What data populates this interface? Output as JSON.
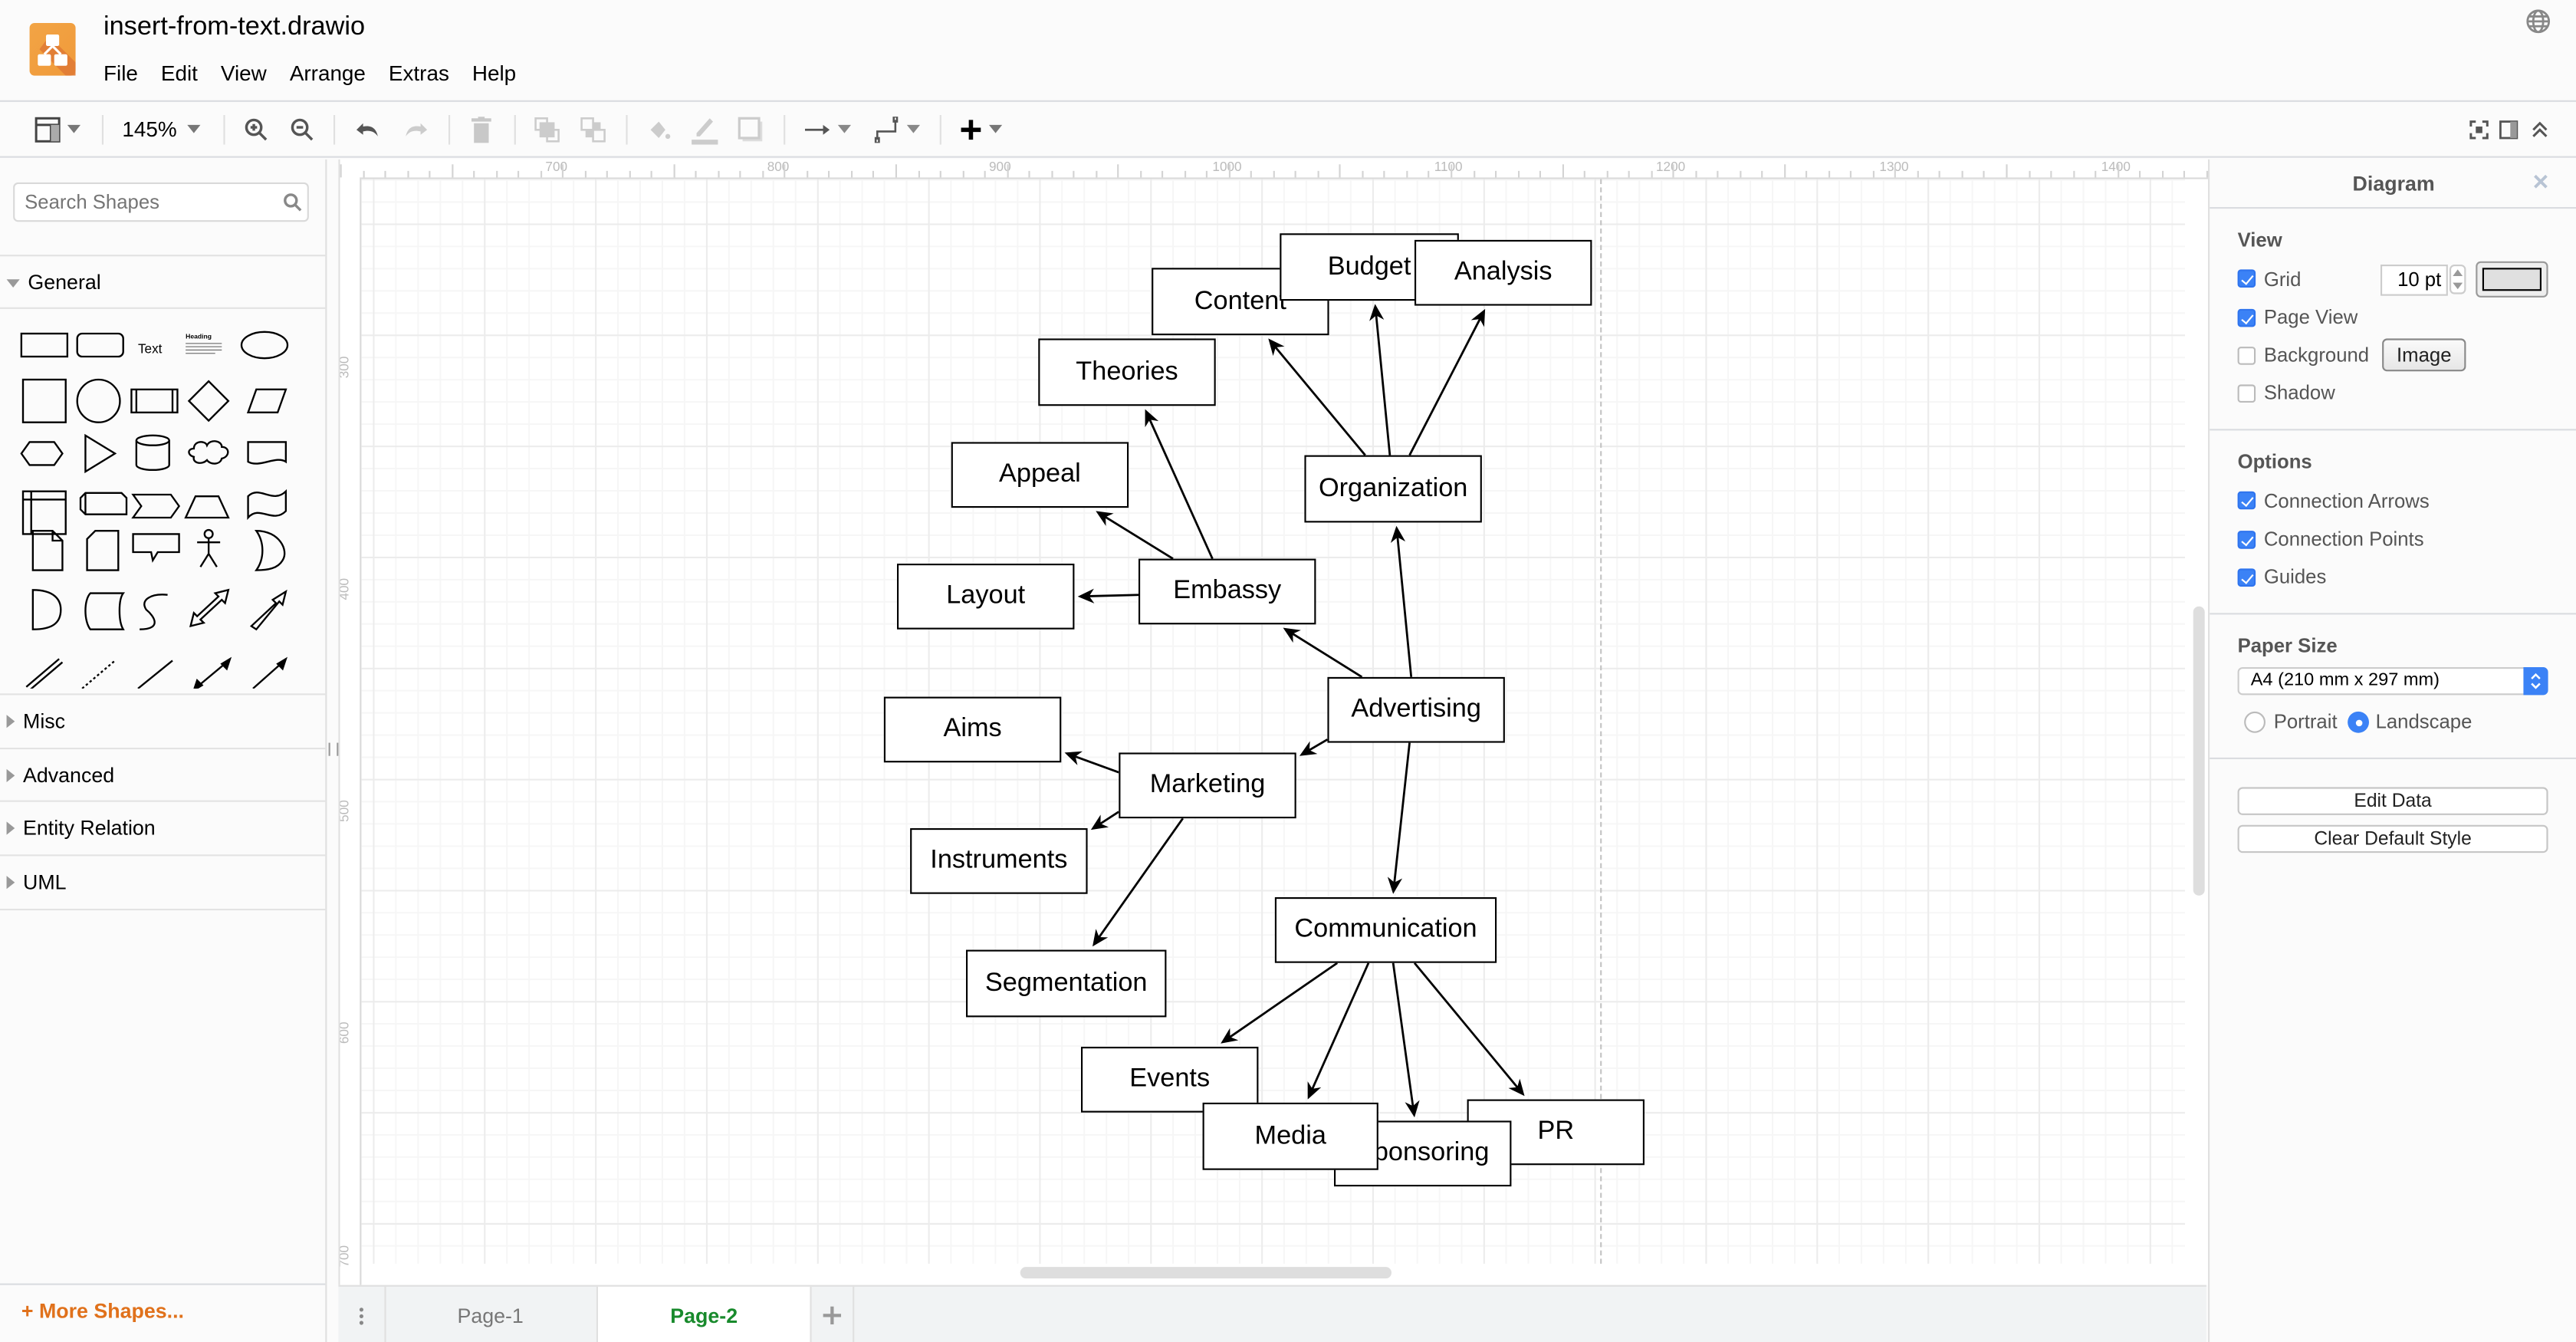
{
  "app": {
    "title": "insert-from-text.drawio",
    "menu": [
      "File",
      "Edit",
      "View",
      "Arrange",
      "Extras",
      "Help"
    ],
    "language_icon": "globe-icon",
    "brand_color": "#f08705"
  },
  "toolbar": {
    "zoom_level": "145%",
    "buttons": [
      {
        "name": "format-panel-toggle",
        "icon": "layout-icon"
      },
      {
        "name": "zoom-in",
        "icon": "zoom-in-icon"
      },
      {
        "name": "zoom-out",
        "icon": "zoom-out-icon"
      },
      {
        "name": "undo",
        "icon": "undo-icon"
      },
      {
        "name": "redo",
        "icon": "redo-icon",
        "disabled": true
      },
      {
        "name": "delete",
        "icon": "trash-icon",
        "disabled": true
      },
      {
        "name": "to-front",
        "icon": "to-front-icon",
        "disabled": true
      },
      {
        "name": "to-back",
        "icon": "to-back-icon",
        "disabled": true
      },
      {
        "name": "fill-color",
        "icon": "fill-color-icon",
        "disabled": true
      },
      {
        "name": "line-color",
        "icon": "line-color-icon",
        "disabled": true
      },
      {
        "name": "shadow",
        "icon": "shadow-icon",
        "disabled": true
      },
      {
        "name": "connection",
        "icon": "connection-arrow-icon"
      },
      {
        "name": "waypoints",
        "icon": "waypoint-icon"
      },
      {
        "name": "insert",
        "icon": "plus-icon"
      },
      {
        "name": "fullscreen",
        "icon": "fullscreen-icon"
      },
      {
        "name": "format-panel",
        "icon": "panel-icon"
      },
      {
        "name": "collapse",
        "icon": "collapse-icon"
      }
    ]
  },
  "sidebar": {
    "search_placeholder": "Search Shapes",
    "sections": [
      {
        "label": "General",
        "expanded": true
      },
      {
        "label": "Misc",
        "expanded": false
      },
      {
        "label": "Advanced",
        "expanded": false
      },
      {
        "label": "Entity Relation",
        "expanded": false
      },
      {
        "label": "UML",
        "expanded": false
      }
    ],
    "general_text_shape": "Text",
    "general_heading_shape": "Heading",
    "more_shapes": "+ More Shapes..."
  },
  "canvas": {
    "ruler_h": [
      "700",
      "800",
      "900",
      "1000",
      "1100",
      "1200",
      "1300",
      "1400"
    ],
    "ruler_v": [
      "300",
      "400",
      "500",
      "600",
      "700"
    ],
    "nodes": [
      {
        "id": "content",
        "label": "Content"
      },
      {
        "id": "budget",
        "label": "Budget"
      },
      {
        "id": "analysis",
        "label": "Analysis"
      },
      {
        "id": "theories",
        "label": "Theories"
      },
      {
        "id": "appeal",
        "label": "Appeal"
      },
      {
        "id": "organization",
        "label": "Organization"
      },
      {
        "id": "layout",
        "label": "Layout"
      },
      {
        "id": "embassy",
        "label": "Embassy"
      },
      {
        "id": "aims",
        "label": "Aims"
      },
      {
        "id": "advertising",
        "label": "Advertising"
      },
      {
        "id": "marketing",
        "label": "Marketing"
      },
      {
        "id": "instruments",
        "label": "Instruments"
      },
      {
        "id": "segmentation",
        "label": "Segmentation"
      },
      {
        "id": "communication",
        "label": "Communication"
      },
      {
        "id": "events",
        "label": "Events"
      },
      {
        "id": "pr",
        "label": "PR"
      },
      {
        "id": "sponsoring",
        "label": "Sponsoring"
      },
      {
        "id": "media",
        "label": "Media"
      }
    ],
    "edges": [
      {
        "from": "organization",
        "to": "content"
      },
      {
        "from": "organization",
        "to": "budget"
      },
      {
        "from": "organization",
        "to": "analysis"
      },
      {
        "from": "embassy",
        "to": "theories"
      },
      {
        "from": "embassy",
        "to": "appeal"
      },
      {
        "from": "embassy",
        "to": "layout"
      },
      {
        "from": "advertising",
        "to": "organization"
      },
      {
        "from": "advertising",
        "to": "embassy"
      },
      {
        "from": "advertising",
        "to": "marketing"
      },
      {
        "from": "advertising",
        "to": "communication"
      },
      {
        "from": "marketing",
        "to": "aims"
      },
      {
        "from": "marketing",
        "to": "instruments"
      },
      {
        "from": "marketing",
        "to": "segmentation"
      },
      {
        "from": "communication",
        "to": "events"
      },
      {
        "from": "communication",
        "to": "media"
      },
      {
        "from": "communication",
        "to": "sponsoring"
      },
      {
        "from": "communication",
        "to": "pr"
      }
    ]
  },
  "pages": {
    "tabs": [
      {
        "label": "Page-1",
        "active": false
      },
      {
        "label": "Page-2",
        "active": true
      }
    ],
    "active_color": "#188a2c"
  },
  "format_panel": {
    "title": "Diagram",
    "view_header": "View",
    "grid": {
      "label": "Grid",
      "checked": true,
      "size": "10 pt"
    },
    "page_view": {
      "label": "Page View",
      "checked": true
    },
    "background": {
      "label": "Background",
      "checked": false,
      "button": "Image"
    },
    "shadow": {
      "label": "Shadow",
      "checked": false
    },
    "options_header": "Options",
    "options": [
      {
        "label": "Connection Arrows",
        "checked": true
      },
      {
        "label": "Connection Points",
        "checked": true
      },
      {
        "label": "Guides",
        "checked": true
      }
    ],
    "paper_header": "Paper Size",
    "paper_size": "A4 (210 mm x 297 mm)",
    "orientation": {
      "portrait": "Portrait",
      "landscape": "Landscape",
      "selected": "Landscape"
    },
    "edit_data": "Edit Data",
    "clear_default_style": "Clear Default Style",
    "accent": "#3b82f6"
  }
}
